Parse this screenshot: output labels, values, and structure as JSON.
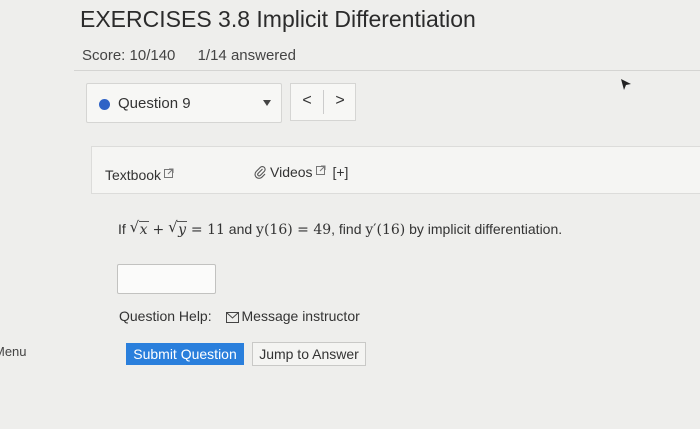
{
  "header": {
    "title": "EXERCISES 3.8 Implicit Differentiation",
    "score": "Score: 10/140",
    "answered": "1/14 answered"
  },
  "question_nav": {
    "selected": "Question 9",
    "prev_label": "<",
    "next_label": ">"
  },
  "resources": {
    "textbook_label": "Textbook",
    "videos_label": "Videos",
    "expand_label": "[+]"
  },
  "problem": {
    "if": "If",
    "x": "x",
    "plus": "+",
    "y": "y",
    "equals_11": "= 11",
    "and": "and",
    "y16": "y(16) = 49",
    "find": ", find",
    "target": "y′(16)",
    "rest": "by implicit differentiation."
  },
  "answer": {
    "value": ""
  },
  "help": {
    "label": "Question Help:",
    "message_link": "Message instructor"
  },
  "menu": {
    "label": "Menu"
  },
  "actions": {
    "submit": "Submit Question",
    "jump": "Jump to Answer"
  },
  "colors": {
    "accent": "#2a7fdc",
    "dot": "#2f63c6"
  }
}
